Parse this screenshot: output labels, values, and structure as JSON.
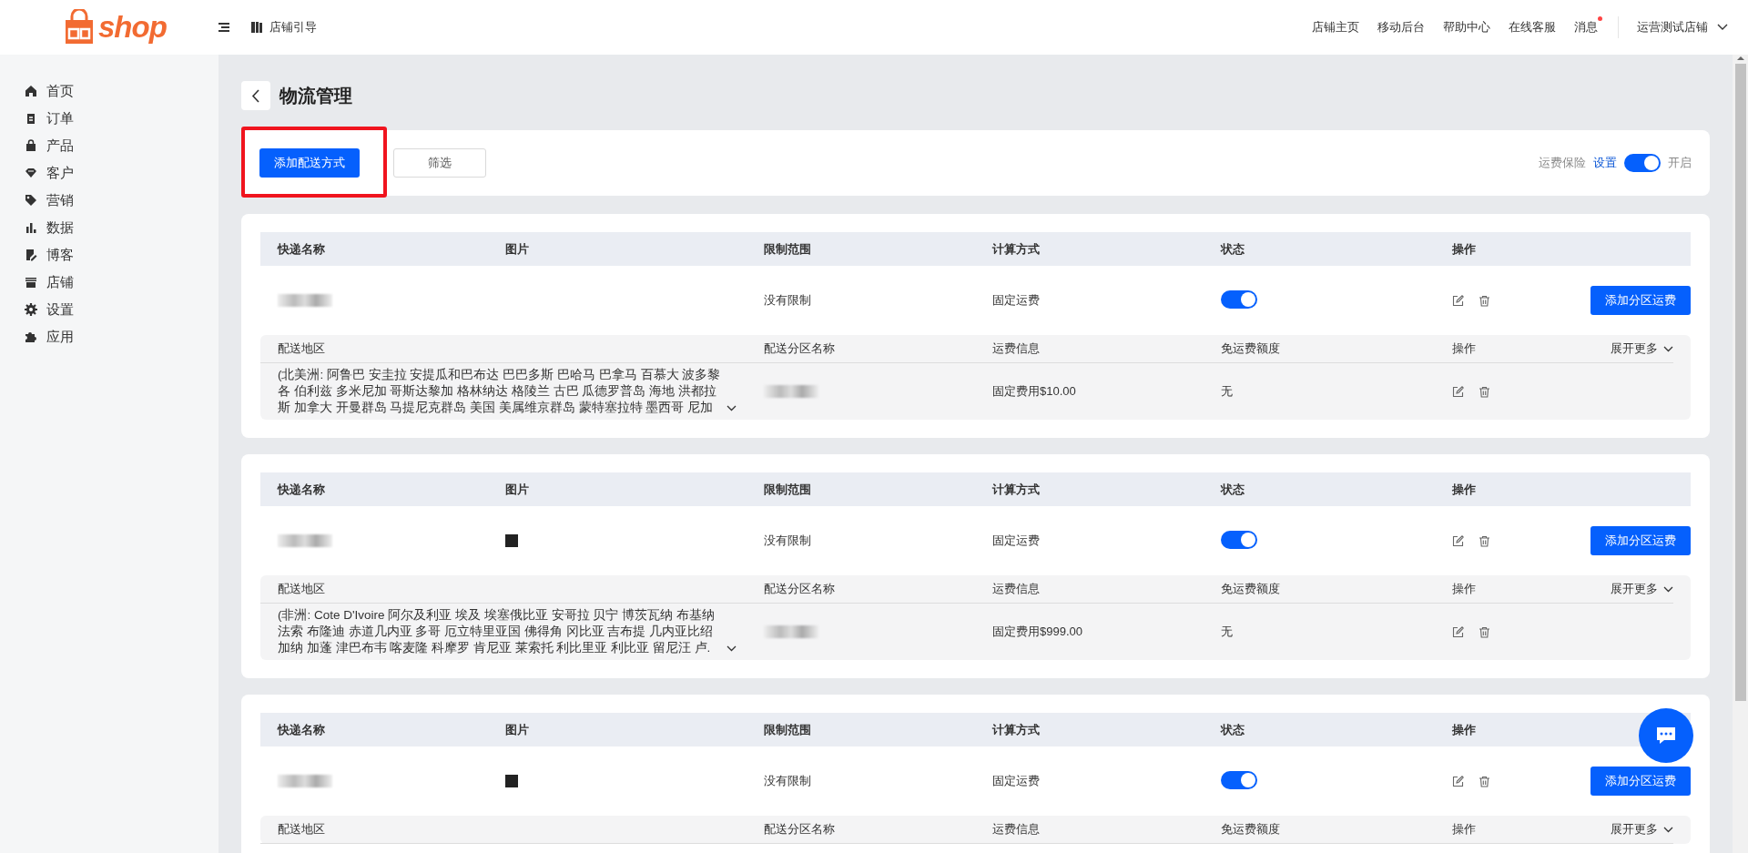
{
  "header": {
    "logo_text": "shop",
    "guide": "店铺引导",
    "links": [
      {
        "label": "店铺主页",
        "has_dot": false
      },
      {
        "label": "移动后台",
        "has_dot": false
      },
      {
        "label": "帮助中心",
        "has_dot": false
      },
      {
        "label": "在线客服",
        "has_dot": false
      },
      {
        "label": "消息",
        "has_dot": true
      }
    ],
    "store": "运营测试店铺"
  },
  "sidebar": {
    "items": [
      "首页",
      "订单",
      "产品",
      "客户",
      "营销",
      "数据",
      "博客",
      "店铺",
      "设置",
      "应用"
    ]
  },
  "page": {
    "title": "物流管理"
  },
  "toolbar": {
    "add_button": {
      "label": "添加配送方式",
      "highlighted": true
    },
    "filter_button": "筛选",
    "insurance": {
      "label": "运费保险",
      "link": "设置",
      "on": true,
      "state_text": "开启"
    }
  },
  "cards": [
    {
      "columns": [
        "快递名称",
        "图片",
        "限制范围",
        "计算方式",
        "状态",
        "操作"
      ],
      "has_image": false,
      "limit": "没有限制",
      "calc": "固定运费",
      "enabled": true,
      "add_zone_button": "添加分区运费",
      "zone_columns": [
        "配送地区",
        "配送分区名称",
        "运费信息",
        "免运费额度",
        "操作"
      ],
      "expand": "展开更多",
      "zones": [
        {
          "region": "(北美洲: 阿鲁巴 安圭拉 安提瓜和巴布达 巴巴多斯 巴哈马 巴拿马 百慕大 波多黎各 伯利兹 多米尼加 哥斯达黎加 格林纳达 格陵兰 古巴 瓜德罗普岛 海地 洪都拉斯 加拿大 开曼群岛 马提尼克群岛 美国 美属维京群岛 蒙特塞拉特 墨西哥 尼加",
          "fee": "固定费用$10.00",
          "free": "无"
        }
      ]
    },
    {
      "columns": [
        "快递名称",
        "图片",
        "限制范围",
        "计算方式",
        "状态",
        "操作"
      ],
      "has_image": true,
      "limit": "没有限制",
      "calc": "固定运费",
      "enabled": true,
      "add_zone_button": "添加分区运费",
      "zone_columns": [
        "配送地区",
        "配送分区名称",
        "运费信息",
        "免运费额度",
        "操作"
      ],
      "expand": "展开更多",
      "zones": [
        {
          "region": "(非洲: Cote D'Ivoire 阿尔及利亚 埃及 埃塞俄比亚 安哥拉 贝宁 博茨瓦纳 布基纳法索 布隆迪 赤道几内亚 多哥 厄立特里亚国 佛得角 冈比亚 吉布提 几内亚比绍加纳 加蓬 津巴布韦 喀麦隆 科摩罗 肯尼亚 莱索托 利比里亚 利比亚 留尼汪 卢.",
          "fee": "固定费用$999.00",
          "free": "无"
        }
      ]
    },
    {
      "columns": [
        "快递名称",
        "图片",
        "限制范围",
        "计算方式",
        "状态",
        "操作"
      ],
      "has_image": true,
      "limit": "没有限制",
      "calc": "固定运费",
      "enabled": true,
      "add_zone_button": "添加分区运费",
      "zone_columns": [
        "配送地区",
        "配送分区名称",
        "运费信息",
        "免运费额度",
        "操作"
      ],
      "expand": "展开更多"
    }
  ]
}
